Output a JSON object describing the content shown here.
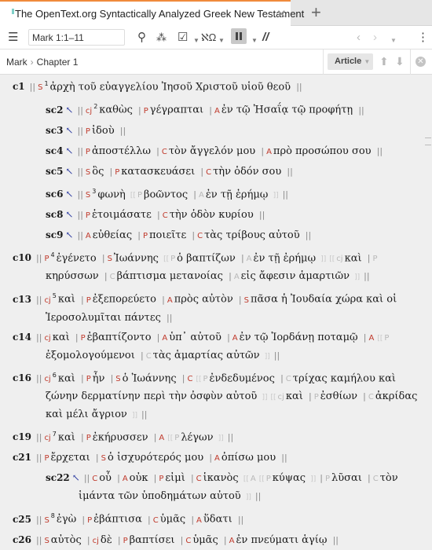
{
  "tab": {
    "title": "The OpenText.org Syntactically Analyzed Greek New Testament",
    "close": "✕",
    "new_tab": "+"
  },
  "toolbar": {
    "reference": "Mark 1:1–11",
    "colors": {
      "accent": "#f08a3c",
      "tag": "#c0392b",
      "arrow": "#2b3aa0"
    }
  },
  "breadcrumb": {
    "book": "Mark",
    "separator": "›",
    "chapter": "Chapter 1"
  },
  "article_label": "Article",
  "rows": [
    {
      "kind": "c",
      "label": "c1",
      "arrow": false,
      "segments": [
        [
          "s",
          "||"
        ],
        [
          "t",
          "S"
        ],
        [
          "n",
          "1"
        ],
        [
          "w",
          "ἀρχὴ τοῦ εὐαγγελίου Ἰησοῦ Χριστοῦ υἱοῦ θεοῦ"
        ],
        [
          "s",
          "||"
        ]
      ]
    },
    {
      "kind": "sc",
      "label": "sc2",
      "arrow": true,
      "segments": [
        [
          "s",
          "||"
        ],
        [
          "t",
          "cj"
        ],
        [
          "n",
          "2"
        ],
        [
          "w",
          "καθὼς"
        ],
        [
          "s",
          "|"
        ],
        [
          "t",
          "P"
        ],
        [
          "w",
          "γέγραπται"
        ],
        [
          "s",
          "|"
        ],
        [
          "t",
          "A"
        ],
        [
          "w",
          "ἐν τῷ Ἠσαΐᾳ τῷ προφήτῃ"
        ],
        [
          "s",
          "||"
        ]
      ]
    },
    {
      "kind": "sc",
      "label": "sc3",
      "arrow": true,
      "segments": [
        [
          "s",
          "||"
        ],
        [
          "t",
          "P"
        ],
        [
          "w",
          "ἰδοὺ"
        ],
        [
          "s",
          "||"
        ]
      ]
    },
    {
      "kind": "sc",
      "label": "sc4",
      "arrow": true,
      "segments": [
        [
          "s",
          "||"
        ],
        [
          "t",
          "P"
        ],
        [
          "w",
          "ἀποστέλλω"
        ],
        [
          "s",
          "|"
        ],
        [
          "t",
          "C"
        ],
        [
          "w",
          "τὸν ἄγγελόν μου"
        ],
        [
          "s",
          "|"
        ],
        [
          "t",
          "A"
        ],
        [
          "w",
          "πρὸ προσώπου σου"
        ],
        [
          "s",
          "||"
        ]
      ]
    },
    {
      "kind": "sc",
      "label": "sc5",
      "arrow": true,
      "segments": [
        [
          "s",
          "||"
        ],
        [
          "t",
          "S"
        ],
        [
          "w",
          "ὃς"
        ],
        [
          "s",
          "|"
        ],
        [
          "t",
          "P"
        ],
        [
          "w",
          "κατασκευάσει"
        ],
        [
          "s",
          "|"
        ],
        [
          "t",
          "C"
        ],
        [
          "w",
          "τὴν ὁδόν σου"
        ],
        [
          "s",
          "||"
        ]
      ]
    },
    {
      "kind": "sc",
      "label": "sc6",
      "arrow": true,
      "segments": [
        [
          "s",
          "||"
        ],
        [
          "t",
          "S"
        ],
        [
          "n",
          "3"
        ],
        [
          "w",
          "φωνὴ"
        ],
        [
          "b",
          "[["
        ],
        [
          "g",
          "P"
        ],
        [
          "w",
          "βοῶντος"
        ],
        [
          "s",
          "|"
        ],
        [
          "g",
          "A"
        ],
        [
          "w",
          "ἐν τῇ ἐρήμῳ"
        ],
        [
          "b",
          "]]"
        ],
        [
          "s",
          "||"
        ]
      ]
    },
    {
      "kind": "sc",
      "label": "sc8",
      "arrow": true,
      "segments": [
        [
          "s",
          "||"
        ],
        [
          "t",
          "P"
        ],
        [
          "w",
          "ἑτοιμάσατε"
        ],
        [
          "s",
          "|"
        ],
        [
          "t",
          "C"
        ],
        [
          "w",
          "τὴν ὁδὸν κυρίου"
        ],
        [
          "s",
          "||"
        ]
      ]
    },
    {
      "kind": "sc",
      "label": "sc9",
      "arrow": true,
      "segments": [
        [
          "s",
          "||"
        ],
        [
          "t",
          "A"
        ],
        [
          "w",
          "εὐθείας"
        ],
        [
          "s",
          "|"
        ],
        [
          "t",
          "P"
        ],
        [
          "w",
          "ποιεῖτε"
        ],
        [
          "s",
          "|"
        ],
        [
          "t",
          "C"
        ],
        [
          "w",
          "τὰς τρίβους αὐτοῦ"
        ],
        [
          "s",
          "||"
        ]
      ]
    },
    {
      "kind": "c",
      "label": "c10",
      "arrow": false,
      "segments": [
        [
          "s",
          "||"
        ],
        [
          "t",
          "P"
        ],
        [
          "n",
          "4"
        ],
        [
          "w",
          "ἐγένετο"
        ],
        [
          "s",
          "|"
        ],
        [
          "t",
          "S"
        ],
        [
          "w",
          "Ἰωάννης"
        ],
        [
          "b",
          "[["
        ],
        [
          "g",
          "P"
        ],
        [
          "w",
          "ὁ βαπτίζων"
        ],
        [
          "s",
          "|"
        ],
        [
          "g",
          "A"
        ],
        [
          "w",
          "ἐν τῇ ἐρήμῳ"
        ],
        [
          "b",
          "]]"
        ],
        [
          "b",
          "[["
        ],
        [
          "g",
          "cj"
        ],
        [
          "w",
          "καὶ"
        ],
        [
          "s",
          "|"
        ],
        [
          "g",
          "P"
        ],
        [
          "nl",
          ""
        ],
        [
          "w",
          "κηρύσσων"
        ],
        [
          "s",
          "|"
        ],
        [
          "g",
          "C"
        ],
        [
          "w",
          "βάπτισμα μετανοίας"
        ],
        [
          "s",
          "|"
        ],
        [
          "g",
          "A"
        ],
        [
          "w",
          "εἰς ἄφεσιν ἁμαρτιῶν"
        ],
        [
          "b",
          "]]"
        ],
        [
          "s",
          "||"
        ]
      ]
    },
    {
      "kind": "c",
      "label": "c13",
      "arrow": false,
      "segments": [
        [
          "s",
          "||"
        ],
        [
          "t",
          "cj"
        ],
        [
          "n",
          "5"
        ],
        [
          "w",
          "καὶ"
        ],
        [
          "s",
          "|"
        ],
        [
          "t",
          "P"
        ],
        [
          "w",
          "ἐξεπορεύετο"
        ],
        [
          "s",
          "|"
        ],
        [
          "t",
          "A"
        ],
        [
          "w",
          "πρὸς αὐτὸν"
        ],
        [
          "s",
          "|"
        ],
        [
          "t",
          "S"
        ],
        [
          "w",
          "πᾶσα ἡ Ἰουδαία χώρα καὶ οἱ"
        ],
        [
          "nl",
          ""
        ],
        [
          "w",
          "Ἱεροσολυμῖται πάντες"
        ],
        [
          "s",
          "||"
        ]
      ]
    },
    {
      "kind": "c",
      "label": "c14",
      "arrow": false,
      "segments": [
        [
          "s",
          "||"
        ],
        [
          "t",
          "cj"
        ],
        [
          "w",
          "καὶ"
        ],
        [
          "s",
          "|"
        ],
        [
          "t",
          "P"
        ],
        [
          "w",
          "ἐβαπτίζοντο"
        ],
        [
          "s",
          "|"
        ],
        [
          "t",
          "A"
        ],
        [
          "w",
          "ὑπ᾽ αὐτοῦ"
        ],
        [
          "s",
          "|"
        ],
        [
          "t",
          "A"
        ],
        [
          "w",
          "ἐν τῷ Ἰορδάνῃ ποταμῷ"
        ],
        [
          "s",
          "|"
        ],
        [
          "t",
          "A"
        ],
        [
          "b",
          "[["
        ],
        [
          "g",
          "P"
        ],
        [
          "nl",
          ""
        ],
        [
          "w",
          "ἐξομολογούμενοι"
        ],
        [
          "s",
          "|"
        ],
        [
          "g",
          "C"
        ],
        [
          "w",
          "τὰς ἁμαρτίας αὐτῶν"
        ],
        [
          "b",
          "]]"
        ],
        [
          "s",
          "||"
        ]
      ]
    },
    {
      "kind": "c",
      "label": "c16",
      "arrow": false,
      "segments": [
        [
          "s",
          "||"
        ],
        [
          "t",
          "cj"
        ],
        [
          "n",
          "6"
        ],
        [
          "w",
          "καὶ"
        ],
        [
          "s",
          "|"
        ],
        [
          "t",
          "P"
        ],
        [
          "w",
          "ἦν"
        ],
        [
          "s",
          "|"
        ],
        [
          "t",
          "S"
        ],
        [
          "w",
          "ὁ Ἰωάννης"
        ],
        [
          "s",
          "|"
        ],
        [
          "t",
          "C"
        ],
        [
          "b",
          "[["
        ],
        [
          "g",
          "P"
        ],
        [
          "w",
          "ἐνδεδυμένος"
        ],
        [
          "s",
          "|"
        ],
        [
          "g",
          "C"
        ],
        [
          "w",
          "τρίχας καμήλου καὶ"
        ],
        [
          "nl",
          ""
        ],
        [
          "w",
          "ζώνην δερματίνην περὶ τὴν ὀσφὺν αὐτοῦ"
        ],
        [
          "b",
          "]]"
        ],
        [
          "b",
          "[["
        ],
        [
          "g",
          "cj"
        ],
        [
          "w",
          "καὶ"
        ],
        [
          "s",
          "|"
        ],
        [
          "g",
          "P"
        ],
        [
          "w",
          "ἐσθίων"
        ],
        [
          "s",
          "|"
        ],
        [
          "g",
          "C"
        ],
        [
          "w",
          "ἀκρίδας"
        ],
        [
          "nl",
          ""
        ],
        [
          "w",
          "καὶ μέλι ἄγριον"
        ],
        [
          "b",
          "]]"
        ],
        [
          "s",
          "||"
        ]
      ]
    },
    {
      "kind": "c",
      "label": "c19",
      "arrow": false,
      "segments": [
        [
          "s",
          "||"
        ],
        [
          "t",
          "cj"
        ],
        [
          "n",
          "7"
        ],
        [
          "w",
          "καὶ"
        ],
        [
          "s",
          "|"
        ],
        [
          "t",
          "P"
        ],
        [
          "w",
          "ἐκήρυσσεν"
        ],
        [
          "s",
          "|"
        ],
        [
          "t",
          "A"
        ],
        [
          "b",
          "[["
        ],
        [
          "g",
          "P"
        ],
        [
          "w",
          "λέγων"
        ],
        [
          "b",
          "]]"
        ],
        [
          "s",
          "||"
        ]
      ]
    },
    {
      "kind": "c",
      "label": "c21",
      "arrow": false,
      "segments": [
        [
          "s",
          "||"
        ],
        [
          "t",
          "P"
        ],
        [
          "w",
          "ἔρχεται"
        ],
        [
          "s",
          "|"
        ],
        [
          "t",
          "S"
        ],
        [
          "w",
          "ὁ ἰσχυρότερός μου"
        ],
        [
          "s",
          "|"
        ],
        [
          "t",
          "A"
        ],
        [
          "w",
          "ὀπίσω μου"
        ],
        [
          "s",
          "||"
        ]
      ]
    },
    {
      "kind": "sc",
      "label": "sc22",
      "arrow": true,
      "segments": [
        [
          "s",
          "||"
        ],
        [
          "t",
          "C"
        ],
        [
          "w",
          "οὗ"
        ],
        [
          "s",
          "|"
        ],
        [
          "t",
          "A"
        ],
        [
          "w",
          "οὐκ"
        ],
        [
          "s",
          "|"
        ],
        [
          "t",
          "P"
        ],
        [
          "w",
          "εἰμὶ"
        ],
        [
          "s",
          "|"
        ],
        [
          "t",
          "C"
        ],
        [
          "w",
          "ἱκανὸς"
        ],
        [
          "b",
          "[["
        ],
        [
          "g",
          "A"
        ],
        [
          "b",
          "[["
        ],
        [
          "g",
          "P"
        ],
        [
          "w",
          "κύψας"
        ],
        [
          "b",
          "]]"
        ],
        [
          "s",
          "|"
        ],
        [
          "g",
          "P"
        ],
        [
          "w",
          "λῦσαι"
        ],
        [
          "s",
          "|"
        ],
        [
          "g",
          "C"
        ],
        [
          "w",
          "τὸν"
        ],
        [
          "nl",
          ""
        ],
        [
          "w",
          "ἱμάντα τῶν ὑποδημάτων αὐτοῦ"
        ],
        [
          "b",
          "]]"
        ],
        [
          "s",
          "||"
        ]
      ]
    },
    {
      "kind": "c",
      "label": "c25",
      "arrow": false,
      "segments": [
        [
          "s",
          "||"
        ],
        [
          "t",
          "S"
        ],
        [
          "n",
          "8"
        ],
        [
          "w",
          "ἐγὼ"
        ],
        [
          "s",
          "|"
        ],
        [
          "t",
          "P"
        ],
        [
          "w",
          "ἐβάπτισα"
        ],
        [
          "s",
          "|"
        ],
        [
          "t",
          "C"
        ],
        [
          "w",
          "ὑμᾶς"
        ],
        [
          "s",
          "|"
        ],
        [
          "t",
          "A"
        ],
        [
          "w",
          "ὕδατι"
        ],
        [
          "s",
          "||"
        ]
      ]
    },
    {
      "kind": "c",
      "label": "c26",
      "arrow": false,
      "segments": [
        [
          "s",
          "||"
        ],
        [
          "t",
          "S"
        ],
        [
          "w",
          "αὐτὸς"
        ],
        [
          "s",
          "|"
        ],
        [
          "t",
          "cj"
        ],
        [
          "w",
          "δὲ"
        ],
        [
          "s",
          "|"
        ],
        [
          "t",
          "P"
        ],
        [
          "w",
          "βαπτίσει"
        ],
        [
          "s",
          "|"
        ],
        [
          "t",
          "C"
        ],
        [
          "w",
          "ὑμᾶς"
        ],
        [
          "s",
          "|"
        ],
        [
          "t",
          "A"
        ],
        [
          "w",
          "ἐν πνεύματι ἁγίῳ"
        ],
        [
          "s",
          "||"
        ]
      ]
    }
  ]
}
